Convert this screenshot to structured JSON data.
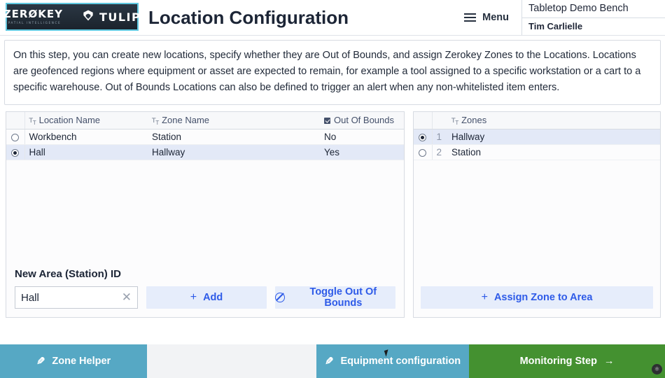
{
  "header": {
    "logo": {
      "zerokey_name": "ZERØKEY",
      "zerokey_tagline": "SPATIAL INTELLIGENCE",
      "tulip_name": "TULIP",
      "tulip_icon": "tulip-diamond-icon",
      "border_color": "#5fc8e0"
    },
    "title": "Location Configuration",
    "menu_label": "Menu",
    "menu_icon": "hamburger-icon",
    "station_name": "Tabletop Demo Bench",
    "user_name": "Tim Carlielle"
  },
  "description": {
    "text": "On this step, you can create new locations, specify whether they are Out of Bounds, and assign Zerokey Zones to the Locations. Locations are geofenced regions where equipment or asset are expected to remain, for example a tool assigned to a specific workstation or a cart to a specific warehouse. Out of Bounds Locations can also be defined to trigger an alert when any non-whitelisted item enters."
  },
  "locations_panel": {
    "columns": [
      "Location Name",
      "Zone Name",
      "Out Of Bounds"
    ],
    "column_icons": [
      "text-type-icon",
      "text-type-icon",
      "checkbox-checked-icon"
    ],
    "rows": [
      {
        "selected": false,
        "location_name": "Workbench",
        "zone_name": "Station",
        "out_of_bounds": "No"
      },
      {
        "selected": true,
        "location_name": "Hall",
        "zone_name": "Hallway",
        "out_of_bounds": "Yes"
      }
    ],
    "form_label": "New Area (Station) ID",
    "input_value": "Hall",
    "input_placeholder": "",
    "clear_icon": "close-x-icon",
    "add_label": "Add",
    "add_icon": "plus-icon",
    "toggle_label": "Toggle Out Of Bounds",
    "toggle_icon": "ban-circle-icon"
  },
  "zones_panel": {
    "column": "Zones",
    "column_icon": "text-type-icon",
    "rows": [
      {
        "selected": true,
        "index": "1",
        "name": "Hallway"
      },
      {
        "selected": false,
        "index": "2",
        "name": "Station"
      }
    ],
    "assign_label": "Assign Zone to Area",
    "assign_icon": "plus-icon"
  },
  "footer": {
    "zone_helper_label": "Zone Helper",
    "zone_helper_icon": "pencil-icon",
    "equipment_label": "Equipment configuration",
    "equipment_icon": "pencil-icon",
    "monitoring_label": "Monitoring Step",
    "monitoring_icon": "arrow-right-icon",
    "teal_color": "#56a8c4",
    "green_color": "#449130"
  },
  "colors": {
    "accent_blue": "#2e5be8",
    "selected_row": "#e3e9f7",
    "title_navy": "#1c2536"
  }
}
